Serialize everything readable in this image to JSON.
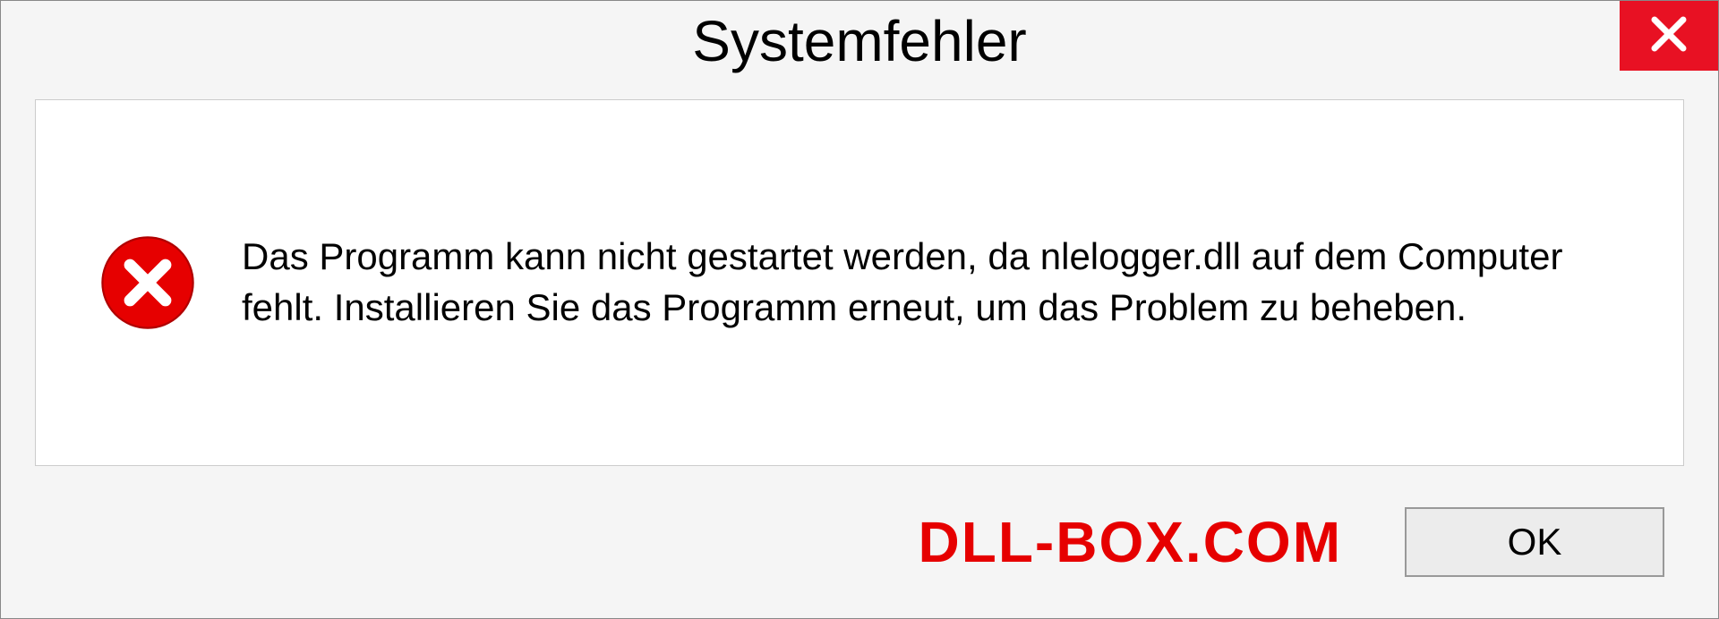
{
  "dialog": {
    "title": "Systemfehler",
    "message": "Das Programm kann nicht gestartet werden, da nlelogger.dll auf dem Computer fehlt. Installieren Sie das Programm erneut, um das Problem zu beheben.",
    "ok_label": "OK"
  },
  "watermark": "DLL-BOX.COM"
}
